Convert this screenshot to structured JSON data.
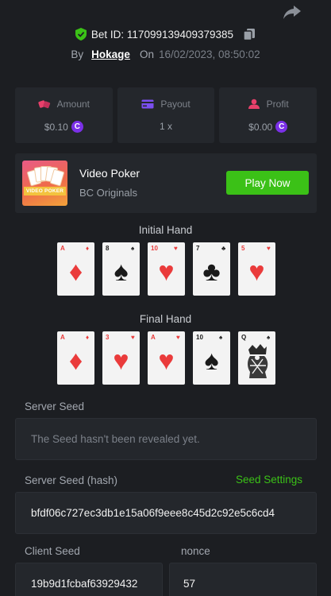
{
  "bet": {
    "id_label": "Bet ID: 117099139409379385",
    "by_label": "By",
    "username": "Hokage",
    "on_label": "On",
    "datetime": "16/02/2023, 08:50:02"
  },
  "stats": {
    "amount": {
      "label": "Amount",
      "value": "$0.10",
      "icon": "dice-icon"
    },
    "payout": {
      "label": "Payout",
      "value": "1 x",
      "icon": "card-icon"
    },
    "profit": {
      "label": "Profit",
      "value": "$0.00",
      "icon": "profit-icon"
    },
    "currency_symbol": "C"
  },
  "game": {
    "title": "Video Poker",
    "subtitle": "BC Originals",
    "thumb_text": "VIDEO POKER",
    "play_label": "Play Now"
  },
  "initial_hand": {
    "label": "Initial Hand",
    "cards": [
      {
        "rank": "A",
        "suit": "♦",
        "color": "red"
      },
      {
        "rank": "8",
        "suit": "♠",
        "color": "black"
      },
      {
        "rank": "10",
        "suit": "♥",
        "color": "red"
      },
      {
        "rank": "7",
        "suit": "♣",
        "color": "black"
      },
      {
        "rank": "5",
        "suit": "♥",
        "color": "red"
      }
    ]
  },
  "final_hand": {
    "label": "Final Hand",
    "cards": [
      {
        "rank": "A",
        "suit": "♦",
        "color": "red"
      },
      {
        "rank": "3",
        "suit": "♥",
        "color": "red"
      },
      {
        "rank": "A",
        "suit": "♥",
        "color": "red"
      },
      {
        "rank": "10",
        "suit": "♠",
        "color": "black"
      },
      {
        "rank": "Q",
        "suit": "♠",
        "color": "black",
        "face": true
      }
    ]
  },
  "seeds": {
    "server_seed_label": "Server Seed",
    "server_seed_value": "The Seed hasn't been revealed yet.",
    "server_hash_label": "Server Seed (hash)",
    "seed_settings_label": "Seed Settings",
    "server_hash_value": "bfdf06c727ec3db1e15a06f9eee8c45d2c92e5c6cd4",
    "client_seed_label": "Client Seed",
    "client_seed_value": "19b9d1fcbaf63929432",
    "nonce_label": "nonce",
    "nonce_value": "57"
  },
  "colors": {
    "background": "#1c1e22",
    "panel": "#24272c",
    "accent_green": "#3bc117",
    "coin_purple": "#7b30e8"
  }
}
